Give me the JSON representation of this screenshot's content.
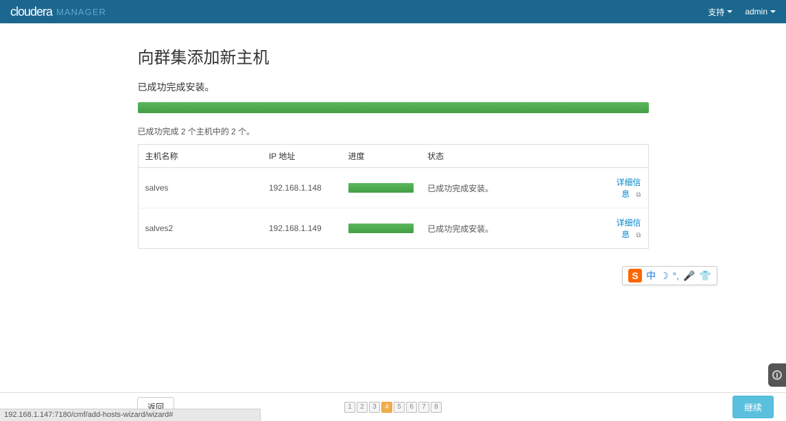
{
  "navbar": {
    "brand_main": "cloudera",
    "brand_sub": "MANAGER",
    "support": "支持",
    "user": "admin"
  },
  "page": {
    "title": "向群集添加新主机",
    "status": "已成功完成安装。",
    "summary": "已成功完成 2 个主机中的 2 个。"
  },
  "table": {
    "headers": {
      "hostname": "主机名称",
      "ip": "IP 地址",
      "progress": "进度",
      "status": "状态"
    },
    "rows": [
      {
        "hostname": "salves",
        "ip": "192.168.1.148",
        "status": "已成功完成安装。",
        "details": "详细信息"
      },
      {
        "hostname": "salves2",
        "ip": "192.168.1.149",
        "status": "已成功完成安装。",
        "details": "详细信息"
      }
    ]
  },
  "footer": {
    "back": "返回",
    "continue": "继续",
    "steps": [
      "1",
      "2",
      "3",
      "4",
      "5",
      "6",
      "7",
      "8"
    ],
    "active_step": 4
  },
  "statusbar": {
    "url": "192.168.1.147:7180/cmf/add-hosts-wizard/wizard#"
  },
  "ime": {
    "logo": "S",
    "lang": "中"
  }
}
